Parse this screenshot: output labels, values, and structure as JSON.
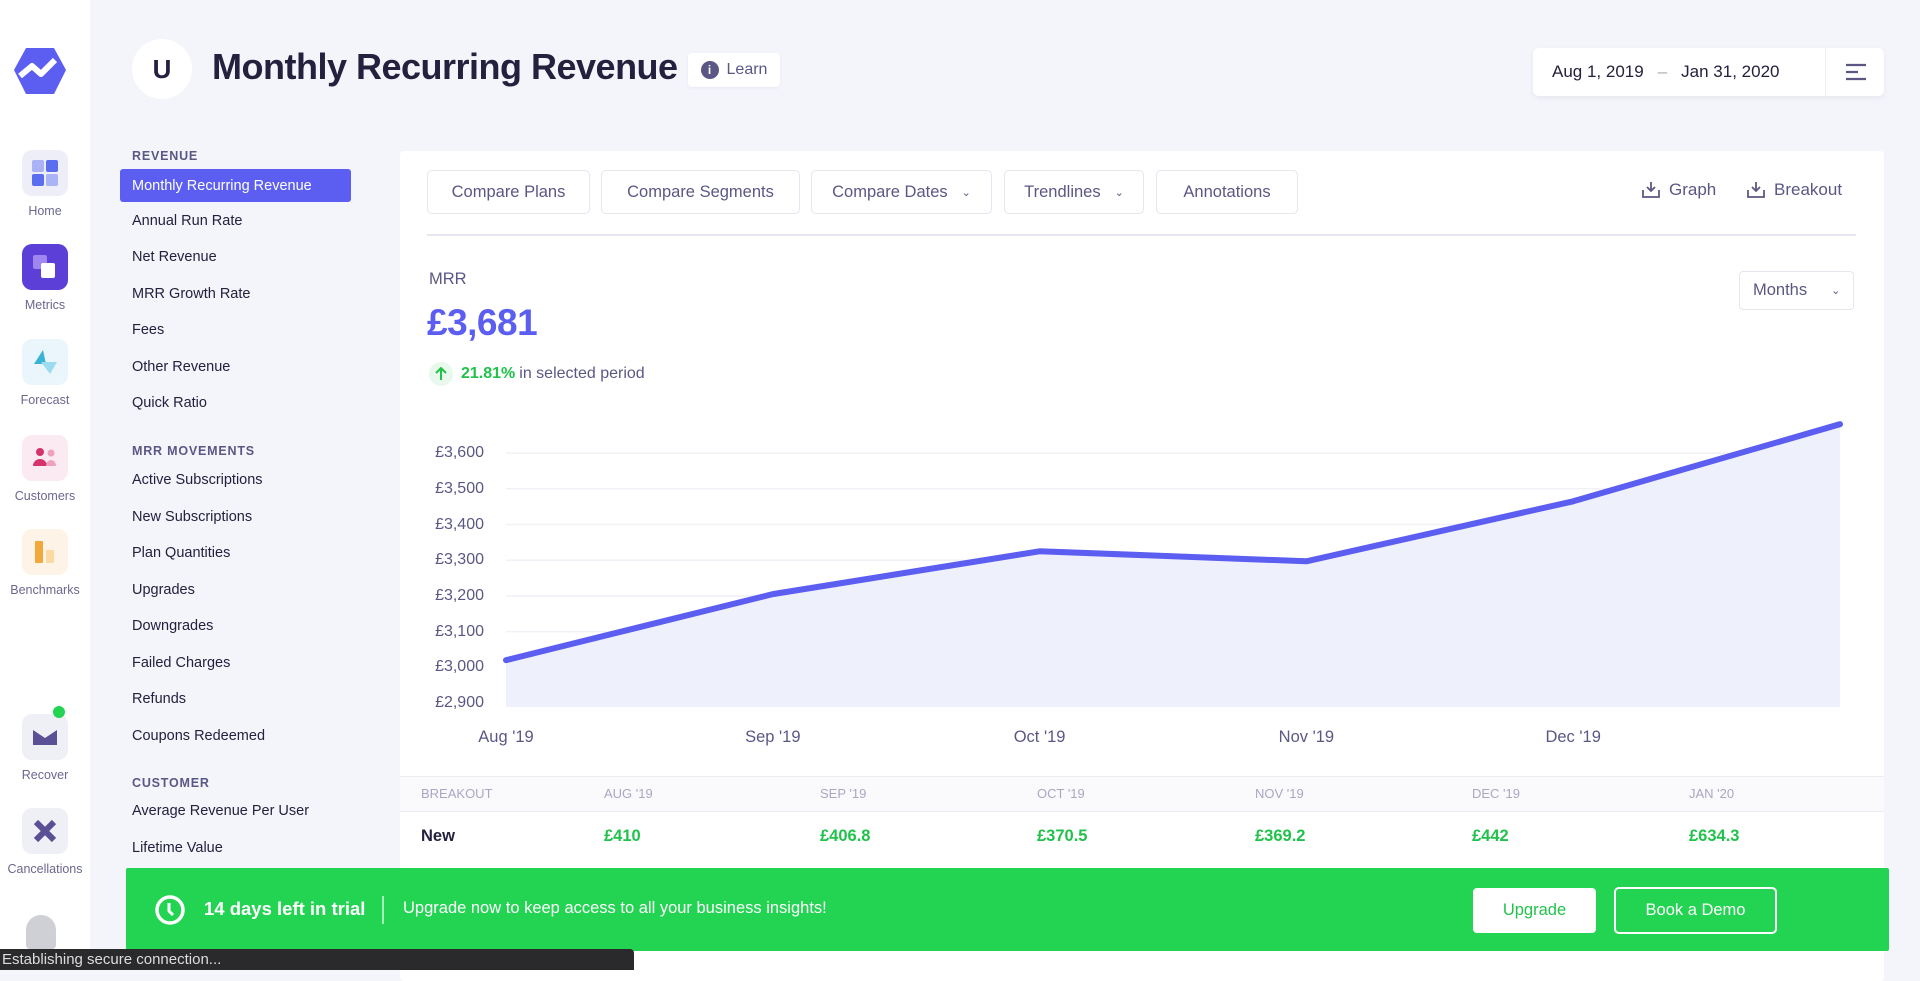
{
  "colors": {
    "accent": "#5b5ef0",
    "positive": "#21c24b",
    "banner": "#22d452",
    "background": "#f4f4fb"
  },
  "rail": {
    "items": [
      {
        "label": "Home",
        "icon": "home-grid-icon"
      },
      {
        "label": "Metrics",
        "icon": "metrics-icon"
      },
      {
        "label": "Forecast",
        "icon": "forecast-icon"
      },
      {
        "label": "Customers",
        "icon": "customers-icon"
      },
      {
        "label": "Benchmarks",
        "icon": "benchmarks-icon"
      },
      {
        "label": "Recover",
        "icon": "mail-icon"
      },
      {
        "label": "Cancellations",
        "icon": "cancel-x-icon"
      }
    ]
  },
  "header": {
    "avatar_letter": "U",
    "title": "Monthly Recurring Revenue",
    "learn": "Learn",
    "date_start": "Aug 1, 2019",
    "date_sep": "–",
    "date_end": "Jan 31, 2020"
  },
  "sidebar": {
    "sections": [
      {
        "title": "REVENUE",
        "items": [
          "Monthly Recurring Revenue",
          "Annual Run Rate",
          "Net Revenue",
          "MRR Growth Rate",
          "Fees",
          "Other Revenue",
          "Quick Ratio"
        ]
      },
      {
        "title": "MRR MOVEMENTS",
        "items": [
          "Active Subscriptions",
          "New Subscriptions",
          "Plan Quantities",
          "Upgrades",
          "Downgrades",
          "Failed Charges",
          "Refunds",
          "Coupons Redeemed"
        ]
      },
      {
        "title": "CUSTOMER",
        "items": [
          "Average Revenue Per User",
          "Lifetime Value"
        ]
      }
    ],
    "active": "Monthly Recurring Revenue"
  },
  "toolbar": {
    "buttons": [
      {
        "label": "Compare Plans",
        "dropdown": false
      },
      {
        "label": "Compare Segments",
        "dropdown": false
      },
      {
        "label": "Compare Dates",
        "dropdown": true
      },
      {
        "label": "Trendlines",
        "dropdown": true
      },
      {
        "label": "Annotations",
        "dropdown": false
      }
    ],
    "download_graph": "Graph",
    "download_breakout": "Breakout"
  },
  "summary": {
    "label": "MRR",
    "value": "£3,681",
    "change": "21.81%",
    "change_suffix": "in selected period",
    "interval": "Months"
  },
  "chart_data": {
    "type": "area",
    "x": [
      "Aug '19",
      "Sep '19",
      "Oct '19",
      "Nov '19",
      "Dec '19",
      "Jan '20"
    ],
    "xtick_labels": [
      "Aug '19",
      "Sep '19",
      "Oct '19",
      "Nov '19",
      "Dec '19"
    ],
    "values": [
      3020,
      3205,
      3325,
      3297,
      3465,
      3681
    ],
    "yticks": [
      "£2,900",
      "£3,000",
      "£3,100",
      "£3,200",
      "£3,300",
      "£3,400",
      "£3,500",
      "£3,600"
    ],
    "ytick_values": [
      2900,
      3000,
      3100,
      3200,
      3300,
      3400,
      3500,
      3600
    ],
    "ylim": [
      2900,
      3681
    ],
    "grid": true,
    "color": "#5b5ef0"
  },
  "breakout": {
    "headers": [
      "BREAKOUT",
      "AUG '19",
      "SEP '19",
      "OCT '19",
      "NOV '19",
      "DEC '19",
      "JAN '20"
    ],
    "rows": [
      {
        "label": "New",
        "values": [
          "£410",
          "£406.8",
          "£370.5",
          "£369.2",
          "£442",
          "£634.3"
        ]
      }
    ]
  },
  "banner": {
    "trial": "14 days left in trial",
    "message": "Upgrade now to keep access to all your business insights!",
    "upgrade": "Upgrade",
    "demo": "Book a Demo"
  },
  "status": "Establishing secure connection..."
}
